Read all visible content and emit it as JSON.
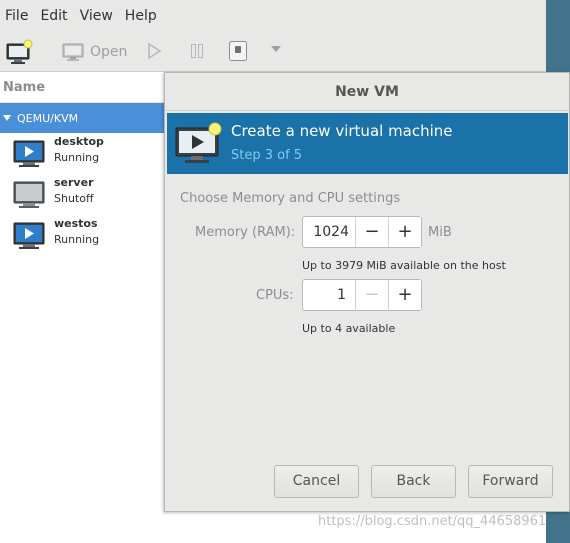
{
  "menubar": {
    "items": [
      "File",
      "Edit",
      "View",
      "Help"
    ]
  },
  "toolbar": {
    "open_label": "Open",
    "icons": [
      "new-vm-icon",
      "monitor-icon",
      "play-icon",
      "pause-icon",
      "shutdown-icon",
      "dropdown-icon"
    ]
  },
  "vm_list": {
    "header": "Name",
    "group": "QEMU/KVM",
    "vms": [
      {
        "name": "desktop",
        "state": "Running"
      },
      {
        "name": "server",
        "state": "Shutoff"
      },
      {
        "name": "westos",
        "state": "Running"
      }
    ]
  },
  "dialog": {
    "title": "New VM",
    "banner_title": "Create a new virtual machine",
    "banner_step": "Step 3 of 5",
    "section_title": "Choose Memory and CPU settings",
    "memory": {
      "label": "Memory (RAM):",
      "value": "1024",
      "unit": "MiB",
      "hint": "Up to 3979 MiB available on the host"
    },
    "cpus": {
      "label": "CPUs:",
      "value": "1",
      "hint": "Up to 4 available"
    },
    "buttons": {
      "cancel": "Cancel",
      "back": "Back",
      "forward": "Forward"
    }
  },
  "watermark": "https://blog.csdn.net/qq_44658961",
  "colors": {
    "banner_bg": "#1a72a9",
    "selection_bg": "#4a90d9",
    "step_text": "#7ecbf2"
  }
}
